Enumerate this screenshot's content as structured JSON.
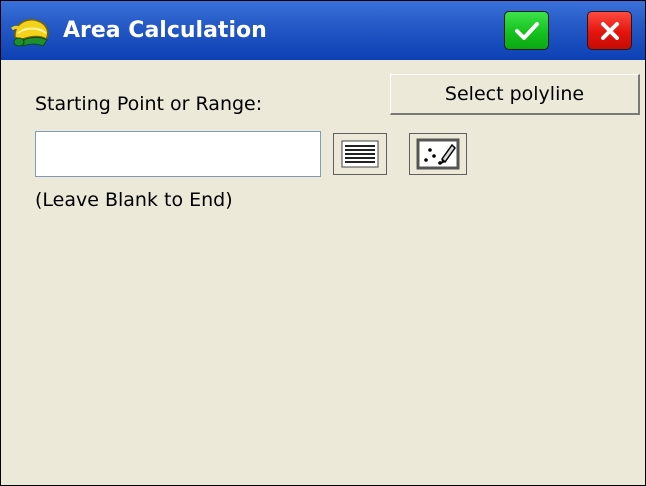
{
  "window": {
    "title": "Area Calculation",
    "title_icon": "helmet-icon",
    "ok_icon": "checkmark-icon",
    "close_icon": "close-icon"
  },
  "form": {
    "starting_point_label": "Starting Point or Range:",
    "starting_point_value": "",
    "select_polyline_label": "Select polyline",
    "list_button_icon": "list-icon",
    "map_button_icon": "map-select-icon",
    "hint": "(Leave Blank to End)"
  },
  "colors": {
    "titlebar": "#2358c5",
    "ok_button": "#14c21d",
    "close_button": "#e3140c",
    "background": "#ece9d8"
  }
}
